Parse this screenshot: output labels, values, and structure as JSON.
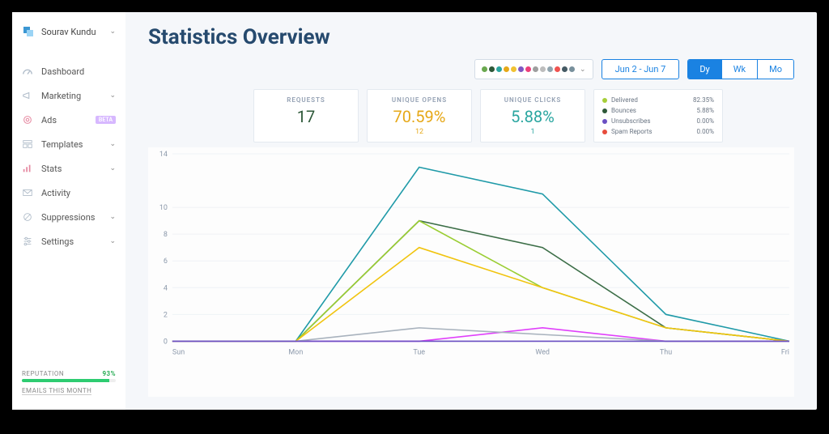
{
  "user": {
    "name": "Sourav Kundu"
  },
  "nav": {
    "dashboard": "Dashboard",
    "marketing": "Marketing",
    "ads": "Ads",
    "ads_badge": "BETA",
    "templates": "Templates",
    "stats": "Stats",
    "activity": "Activity",
    "suppressions": "Suppressions",
    "settings": "Settings"
  },
  "footer": {
    "reputation_label": "REPUTATION",
    "reputation_value": "93%",
    "emails_month": "EMAILS THIS MONTH"
  },
  "page_title": "Statistics Overview",
  "date_range": "Jun 2 - Jun 7",
  "range": {
    "dy": "Dy",
    "wk": "Wk",
    "mo": "Mo"
  },
  "legend_dots": [
    "#6aa84f",
    "#2d5838",
    "#2aa6a0",
    "#e6a817",
    "#f1c232",
    "#7e57c2",
    "#ec407a",
    "#9e9e9e",
    "#bdbdbd",
    "#90a4ae",
    "#ef5350",
    "#455a64",
    "#78909c"
  ],
  "stats": {
    "requests": {
      "label": "REQUESTS",
      "value": "17"
    },
    "opens": {
      "label": "UNIQUE OPENS",
      "value": "70.59%",
      "sub": "12"
    },
    "clicks": {
      "label": "UNIQUE CLICKS",
      "value": "5.88%",
      "sub": "1"
    }
  },
  "mini_legend": [
    {
      "label": "Delivered",
      "value": "82.35%",
      "color": "#a6ce39"
    },
    {
      "label": "Bounces",
      "value": "5.88%",
      "color": "#2d5838"
    },
    {
      "label": "Unsubscribes",
      "value": "0.00%",
      "color": "#6a4fc2"
    },
    {
      "label": "Spam Reports",
      "value": "0.00%",
      "color": "#e74c3c"
    }
  ],
  "chart_data": {
    "type": "line",
    "title": "Statistics Overview",
    "xlabel": "",
    "ylabel": "",
    "categories": [
      "Sun",
      "Mon",
      "Tue",
      "Wed",
      "Thu",
      "Fri"
    ],
    "ylim": [
      0,
      14
    ],
    "yticks": [
      0,
      2,
      4,
      6,
      8,
      10,
      14
    ],
    "series": [
      {
        "name": "teal",
        "color": "#1f9aa8",
        "values": [
          0,
          0,
          13,
          11,
          2,
          0
        ]
      },
      {
        "name": "dark-green",
        "color": "#3c6e47",
        "values": [
          0,
          0,
          9,
          7,
          1,
          0
        ]
      },
      {
        "name": "lime-green",
        "color": "#9acd32",
        "values": [
          0,
          0,
          9,
          4,
          1,
          0
        ]
      },
      {
        "name": "yellow",
        "color": "#f1c40f",
        "values": [
          0,
          0,
          7,
          4,
          1,
          0
        ]
      },
      {
        "name": "magenta",
        "color": "#e040fb",
        "values": [
          0,
          0,
          0,
          1,
          0,
          0
        ]
      },
      {
        "name": "grey",
        "color": "#a8b2bd",
        "values": [
          0,
          0,
          1,
          0.5,
          0,
          0
        ]
      },
      {
        "name": "purple-flat",
        "color": "#6a4fc2",
        "values": [
          0,
          0,
          0,
          0,
          0,
          0
        ]
      }
    ]
  }
}
